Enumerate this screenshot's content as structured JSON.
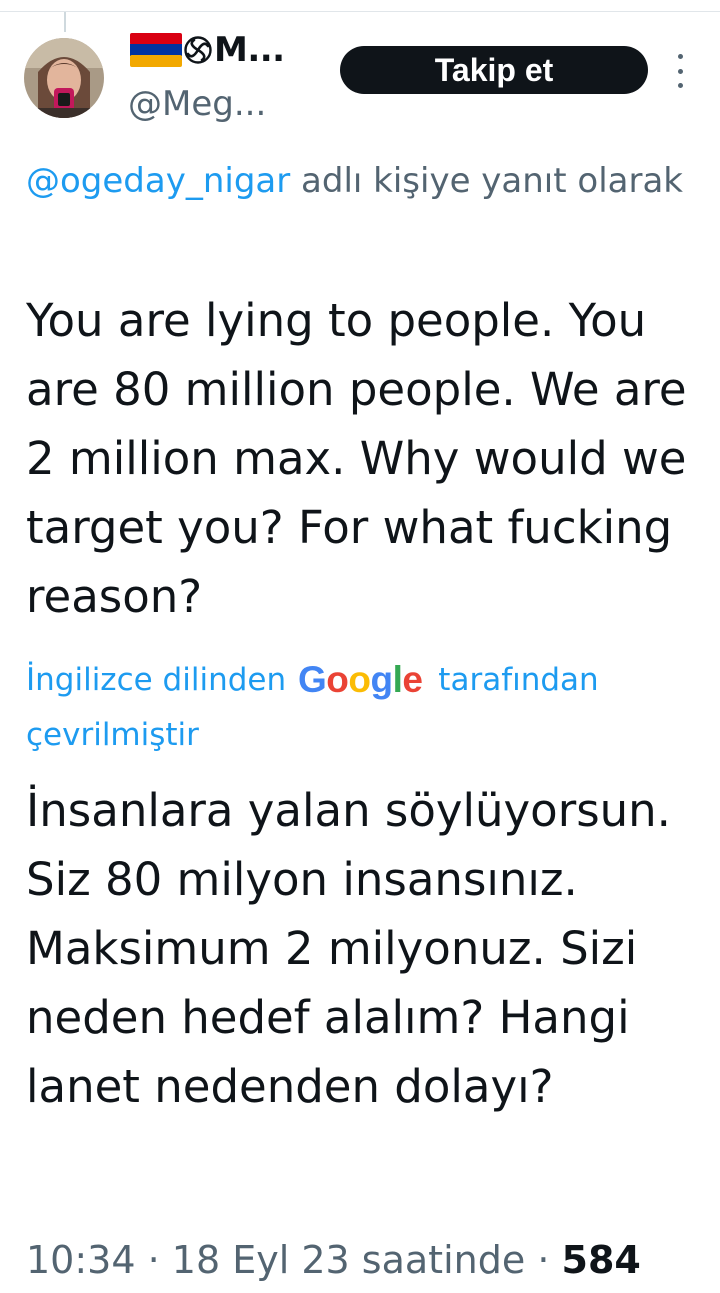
{
  "author": {
    "display_name": "M...",
    "handle": "@Meg...",
    "flag_colors": [
      "#d90012",
      "#0033a0",
      "#f2a800"
    ],
    "emblem_icon": "eternity-swirl-icon"
  },
  "follow_button": {
    "label": "Takip et"
  },
  "reply_context": {
    "mention": "@ogeday_nigar",
    "text": " adlı kişiye yanıt olarak"
  },
  "tweet": {
    "text": "You are lying to people. You are 80 million people. We are 2 million max. Why would we target you? For what fucking reason?"
  },
  "translation": {
    "prefix": "İngilizce dilinden",
    "google_logo": [
      "G",
      "o",
      "o",
      "g",
      "l",
      "e"
    ],
    "suffix": "tarafından çevrilmiştir",
    "text": "İnsanlara yalan söylüyorsun. Siz 80 milyon insansınız. Maksimum 2 milyonuz. Sizi neden hedef alalım? Hangi lanet nedenden dolayı?"
  },
  "meta": {
    "time": "10:34",
    "date": "18 Eyl 23 saatinde",
    "separator": "·",
    "views": "584"
  },
  "colors": {
    "accent": "#1d9bf0",
    "text_primary": "#0f1419",
    "text_secondary": "#536471",
    "button_bg": "#0f1419"
  }
}
